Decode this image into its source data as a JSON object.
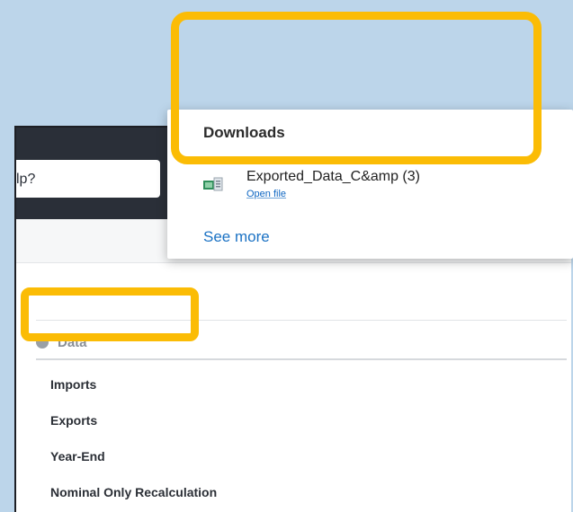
{
  "search": {
    "partial_text": "lp?"
  },
  "downloads": {
    "title": "Downloads",
    "items": [
      {
        "file_name": "Exported_Data_C&amp (3)",
        "action_label": "Open file",
        "icon": "excel-file-icon"
      }
    ],
    "see_more_label": "See more"
  },
  "navigation": {
    "section_label": "Data",
    "section_icon": "data-icon",
    "items": [
      {
        "label": "Imports"
      },
      {
        "label": "Exports"
      },
      {
        "label": "Year-End"
      },
      {
        "label": "Nominal Only Recalculation"
      }
    ]
  },
  "colors": {
    "background": "#bcd5ea",
    "highlight": "#fbbc05",
    "link": "#1b72c4",
    "top_bar": "#2a2f38"
  }
}
